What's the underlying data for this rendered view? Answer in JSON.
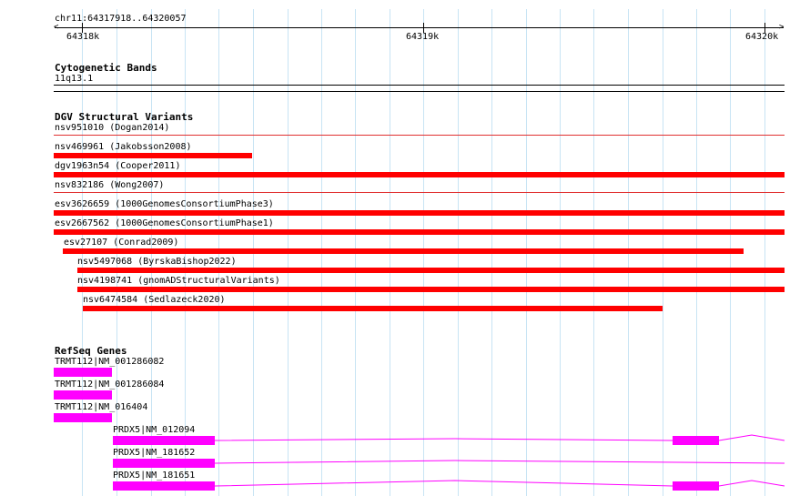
{
  "ruler": {
    "location": "chr11:64317918..64320057",
    "ticks": [
      {
        "label": "64318k",
        "pos": 64318000
      },
      {
        "label": "64319k",
        "pos": 64319000
      },
      {
        "label": "64320k",
        "pos": 64320000
      }
    ]
  },
  "cytobands": {
    "title": "Cytogenetic Bands",
    "band": "11q13.1"
  },
  "dgv": {
    "title": "DGV Structural Variants",
    "items": [
      {
        "label": "nsv951010 (Dogan2014)"
      },
      {
        "label": "nsv469961 (Jakobsson2008)"
      },
      {
        "label": "dgv1963n54 (Cooper2011)"
      },
      {
        "label": "nsv832186 (Wong2007)"
      },
      {
        "label": "esv3626659 (1000GenomesConsortiumPhase3)"
      },
      {
        "label": "esv2667562 (1000GenomesConsortiumPhase1)"
      },
      {
        "label": "esv27107 (Conrad2009)"
      },
      {
        "label": "nsv5497068 (ByrskaBishop2022)"
      },
      {
        "label": "nsv4198741 (gnomADStructuralVariants)"
      },
      {
        "label": "nsv6474584 (Sedlazeck2020)"
      }
    ]
  },
  "refseq": {
    "title": "RefSeq Genes",
    "transcripts": [
      {
        "label": "TRMT112|NM_001286082"
      },
      {
        "label": "TRMT112|NM_001286084"
      },
      {
        "label": "TRMT112|NM_016404"
      },
      {
        "label": "PRDX5|NM_012094"
      },
      {
        "label": "PRDX5|NM_181652"
      },
      {
        "label": "PRDX5|NM_181651"
      }
    ]
  },
  "colors": {
    "variant": "#ff0000",
    "gene": "#ff00ff",
    "grid": "#c8e4f4",
    "separator": "#e03030"
  }
}
